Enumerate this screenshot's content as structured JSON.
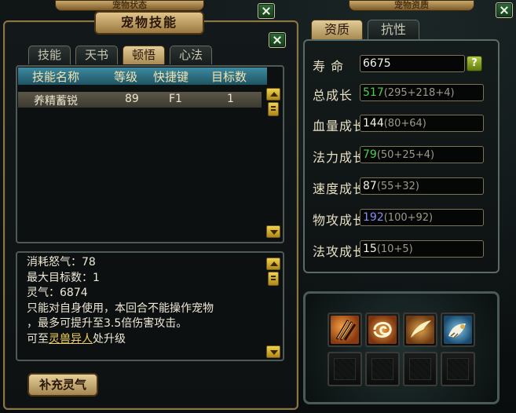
{
  "windows": {
    "pet_status_title": "宠物状态",
    "pet_aptitude_title": "宠物资质"
  },
  "skill_panel": {
    "title": "宠物技能",
    "tabs": [
      "技能",
      "天书",
      "顿悟",
      "心法"
    ],
    "active_tab": "顿悟",
    "columns": [
      "技能名称",
      "等级",
      "快捷键",
      "目标数"
    ],
    "rows": [
      {
        "name": "养精蓄锐",
        "level": "89",
        "hotkey": "F1",
        "targets": "1"
      }
    ],
    "description": {
      "line1": "消耗怒气：78",
      "line2": "最大目标数：1",
      "line3": "灵气：6874",
      "line4": "只能对自身使用，本回合不能操作宠物",
      "line5": "，最多可提升至3.5倍伤害攻击。",
      "line6_prefix": "可至",
      "line6_link": "灵兽异人",
      "line6_suffix": "处升级"
    },
    "supplement_button": "补充灵气"
  },
  "aptitude_panel": {
    "tabs": [
      "资质",
      "抗性"
    ],
    "active_tab": "资质",
    "lifespan": {
      "label": "寿 命",
      "value": "6675",
      "help": "?"
    },
    "attributes": [
      {
        "label": "总成长",
        "value": "517",
        "detail": "(295+218+4)",
        "color": "#4ccf4c"
      },
      {
        "label": "血量成长",
        "value": "144",
        "detail": "(80+64)",
        "color": "#f4f1e6"
      },
      {
        "label": "法力成长",
        "value": "79",
        "detail": "(50+25+4)",
        "color": "#4ccf4c"
      },
      {
        "label": "速度成长",
        "value": "87",
        "detail": "(55+32)",
        "color": "#f4f1e6"
      },
      {
        "label": "物攻成长",
        "value": "192",
        "detail": "(100+92)",
        "color": "#8a8cf0"
      },
      {
        "label": "法攻成长",
        "value": "15",
        "detail": "(10+5)",
        "color": "#f4f1e6"
      }
    ]
  },
  "skill_slots": {
    "icons": [
      "claw-slash-icon",
      "swirl-icon",
      "wing-icon",
      "tiger-claw-icon"
    ]
  }
}
